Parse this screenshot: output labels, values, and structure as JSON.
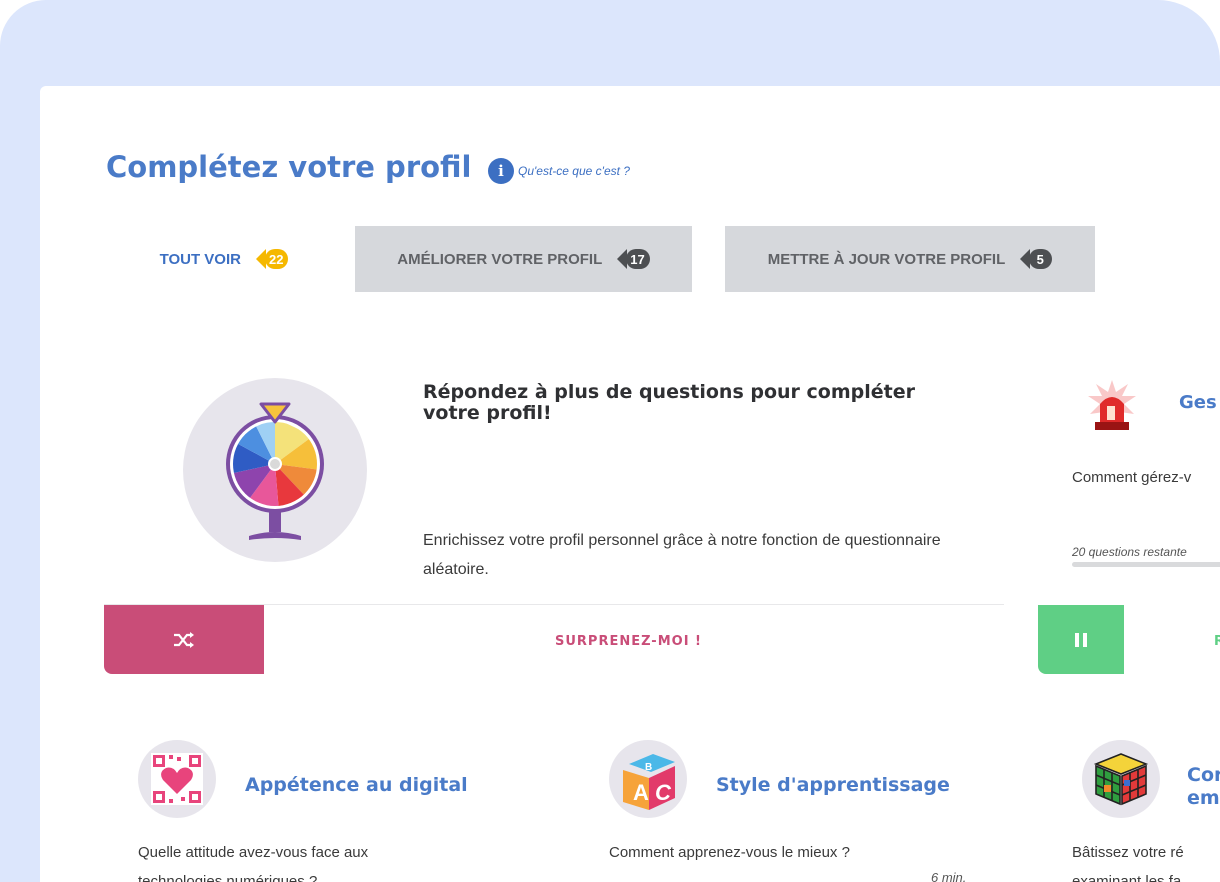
{
  "page": {
    "title": "Complétez votre profil",
    "info_link": "Qu'est-ce que c'est ?"
  },
  "tabs": [
    {
      "label": "TOUT VOIR",
      "count": "22",
      "active": true
    },
    {
      "label": "AMÉLIORER VOTRE PROFIL",
      "count": "17",
      "active": false
    },
    {
      "label": "METTRE À JOUR VOTRE PROFIL",
      "count": "5",
      "active": false
    }
  ],
  "featured": {
    "heading": "Répondez à plus de questions pour compléter votre profil!",
    "description": "Enrichissez votre profil personnel grâce à notre fonction de questionnaire aléatoire.",
    "action_label": "SURPRENEZ-MOI !",
    "action_icon": "shuffle-icon"
  },
  "side_card": {
    "title": "Ges",
    "question": "Comment gérez-v",
    "remaining": "20 questions restante",
    "action_label": "R",
    "action_icon": "pause-icon"
  },
  "questionnaires": [
    {
      "title": "Appétence au digital",
      "question": "Quelle attitude avez-vous face aux",
      "question_line2": "technologies numériques ?",
      "icon": "qr-heart-icon"
    },
    {
      "title": "Style d'apprentissage",
      "question": "Comment apprenez-vous le mieux ?",
      "time": "6 min.",
      "icon": "abc-block-icon"
    },
    {
      "title": "Cor",
      "title_line2": "em",
      "question": "Bâtissez votre ré",
      "question_line2": "examinant les fa",
      "icon": "rubiks-cube-icon"
    }
  ],
  "colors": {
    "primary": "#4a7bc8",
    "pink": "#c94d78",
    "green": "#5fcf85",
    "badge_yellow": "#f5b800",
    "badge_dark": "#4d4f52",
    "background": "#dce6fc"
  }
}
